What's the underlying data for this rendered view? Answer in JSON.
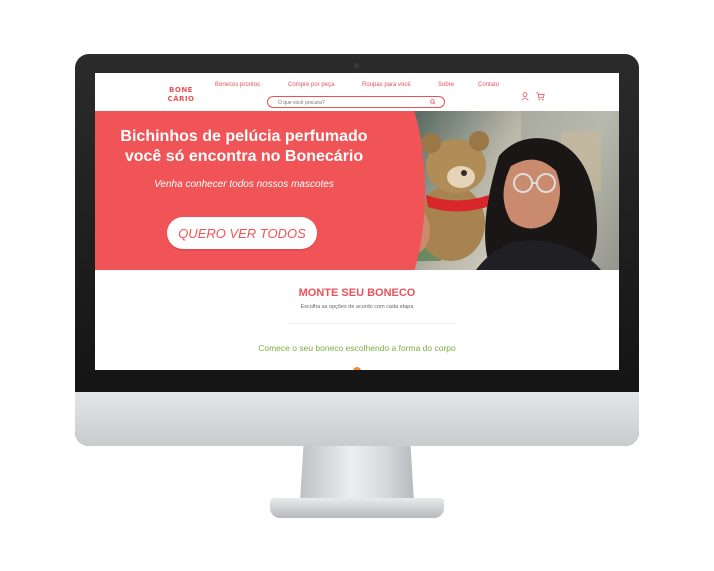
{
  "logo": {
    "line1": "BONE",
    "line2": "CÁRIO"
  },
  "nav": {
    "items": [
      {
        "label": "Bonecos prontos"
      },
      {
        "label": "Compre por peça"
      },
      {
        "label": "Roupas para você"
      },
      {
        "label": "Sobre"
      },
      {
        "label": "Contato"
      }
    ]
  },
  "search": {
    "placeholder": "O que você procura?"
  },
  "hero": {
    "title": "Bichinhos de pelúcia perfumado você só encontra no Bonecário",
    "subtitle": "Venha conhecer todos nossos mascotes",
    "cta": "QUERO VER TODOS"
  },
  "build": {
    "title": "MONTE SEU BONECO",
    "subtitle": "Escolha as opções de acordo com cada etapa",
    "step": "Comece o seu boneco escolhendo a forma do corpo"
  },
  "colors": {
    "brand": "#f15456",
    "accent_green": "#7cae3d",
    "dot": "#f08a3a"
  },
  "icons": [
    "search-icon",
    "user-icon",
    "cart-icon"
  ]
}
